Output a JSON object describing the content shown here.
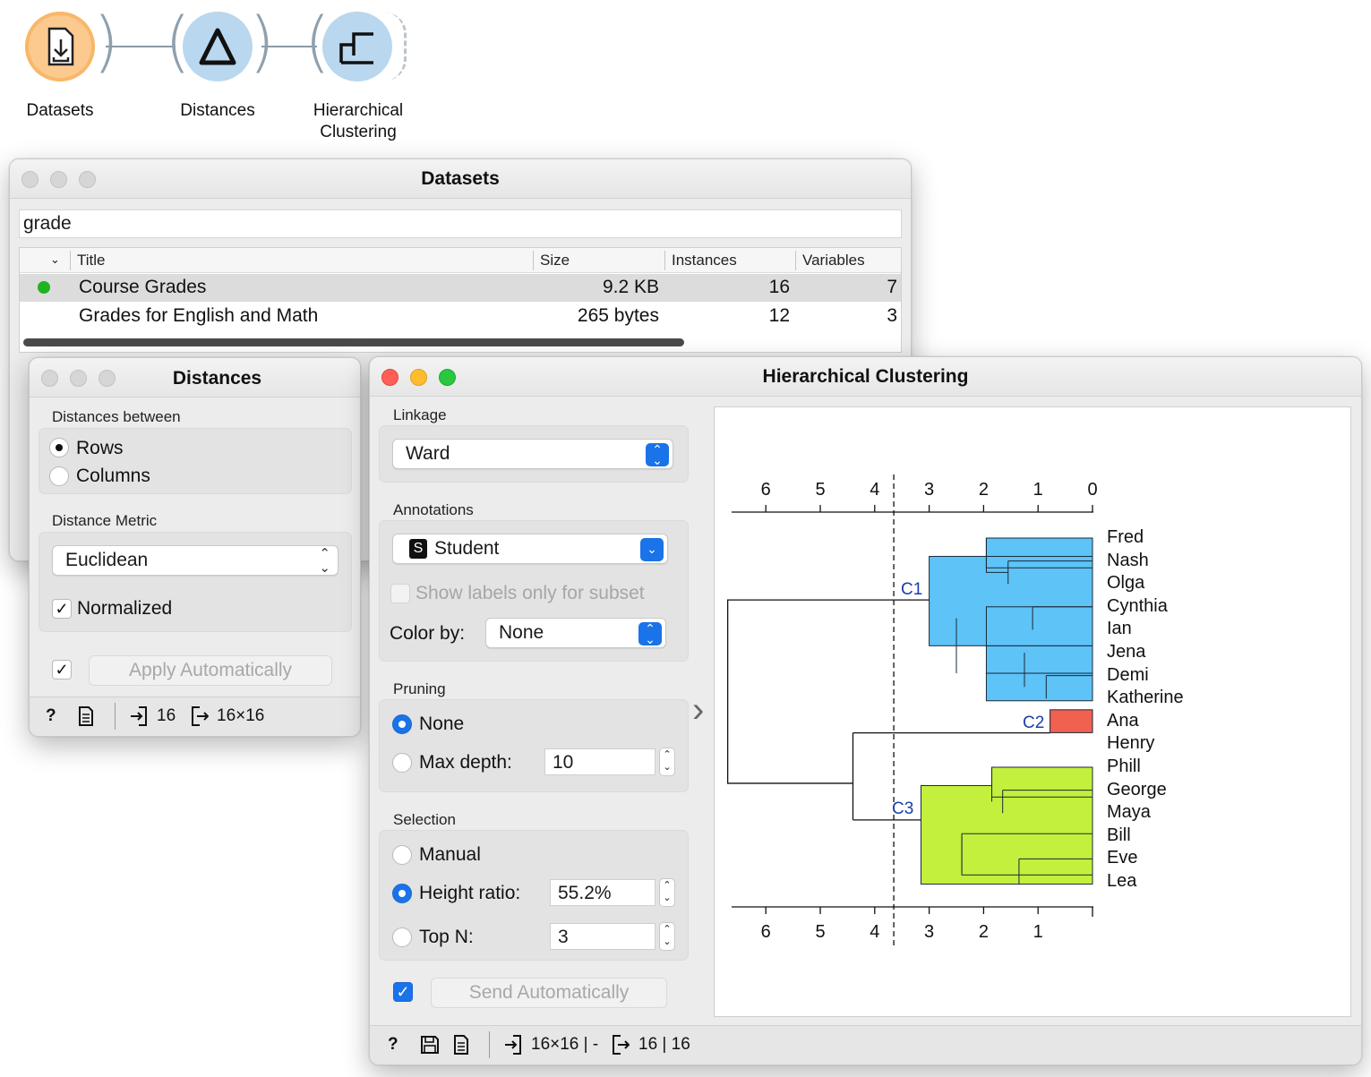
{
  "workflow": {
    "nodes": [
      {
        "label": "Datasets",
        "icon": "datasets-icon",
        "color": "#fcc98f"
      },
      {
        "label": "Distances",
        "icon": "delta-icon",
        "color": "#b9d7ee"
      },
      {
        "label": "Hierarchical Clustering",
        "icon": "dendrogram-icon",
        "color": "#b9d7ee"
      }
    ]
  },
  "datasets_window": {
    "title": "Datasets",
    "search_value": "grade",
    "columns": [
      "Title",
      "Size",
      "Instances",
      "Variables"
    ],
    "rows": [
      {
        "title": "Course Grades",
        "size": "9.2 KB",
        "instances": "16",
        "variables": "7",
        "status": "green"
      },
      {
        "title": "Grades for English and Math",
        "size": "265 bytes",
        "instances": "12",
        "variables": "3",
        "status": "none"
      }
    ]
  },
  "distances_window": {
    "title": "Distances",
    "between_label": "Distances between",
    "between_options": [
      "Rows",
      "Columns"
    ],
    "between_selected": "Rows",
    "metric_label": "Distance Metric",
    "metric_value": "Euclidean",
    "normalized_label": "Normalized",
    "normalized_checked": true,
    "apply_auto_label": "Apply Automatically",
    "apply_auto_checked": true,
    "status_in": "16",
    "status_out": "16×16"
  },
  "hc_window": {
    "title": "Hierarchical Clustering",
    "linkage_label": "Linkage",
    "linkage_value": "Ward",
    "annotations_label": "Annotations",
    "annotation_value": "Student",
    "annotation_badge": "S",
    "show_labels_subset": "Show labels only for subset",
    "color_by_label": "Color by:",
    "color_by_value": "None",
    "pruning_label": "Pruning",
    "pruning_none": "None",
    "pruning_max_depth": "Max depth:",
    "max_depth_value": "10",
    "selection_label": "Selection",
    "sel_manual": "Manual",
    "sel_height_ratio": "Height ratio:",
    "height_ratio_value": "55.2%",
    "sel_top_n": "Top N:",
    "top_n_value": "3",
    "send_auto_label": "Send Automatically",
    "send_auto_checked": true,
    "status_in": "16×16 | -",
    "status_out": "16 | 16",
    "expand_arrow": "›"
  },
  "chart_data": {
    "type": "dendrogram",
    "axis_ticks": [
      "6",
      "5",
      "4",
      "3",
      "2",
      "1",
      "0"
    ],
    "bottom_ticks": [
      "6",
      "5",
      "4",
      "3",
      "2",
      "1"
    ],
    "leaves": [
      "Fred",
      "Nash",
      "Olga",
      "Cynthia",
      "Ian",
      "Jena",
      "Demi",
      "Katherine",
      "Ana",
      "Henry",
      "Phill",
      "George",
      "Maya",
      "Bill",
      "Eve",
      "Lea"
    ],
    "cut_height": 3.65,
    "clusters": [
      {
        "name": "C1",
        "color": "#5ec3f7",
        "height": 3.0
      },
      {
        "name": "C2",
        "color": "#f0614f",
        "height": 0.0
      },
      {
        "name": "C3",
        "color": "#c2f03c",
        "height": 3.15
      }
    ],
    "root_height": 6.7
  }
}
